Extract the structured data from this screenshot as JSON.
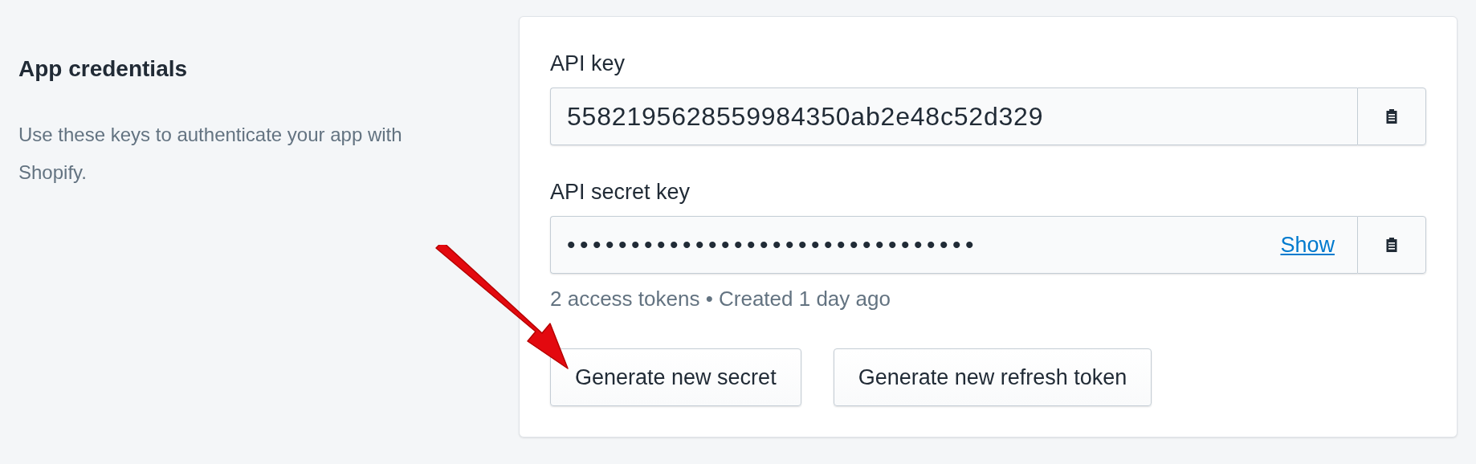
{
  "section": {
    "title": "App credentials",
    "description": "Use these keys to authenticate your app with Shopify."
  },
  "fields": [
    {
      "kind": "plain",
      "label": "API key",
      "value": "5582195628559984350ab2e48c52d329"
    },
    {
      "kind": "secret",
      "label": "API secret key",
      "value": "••••••••••••••••••••••••••••••••",
      "link": "Show"
    }
  ],
  "hint": "2 access tokens • Created 1 day ago",
  "buttons": [
    "Generate new secret",
    "Generate new refresh token"
  ]
}
